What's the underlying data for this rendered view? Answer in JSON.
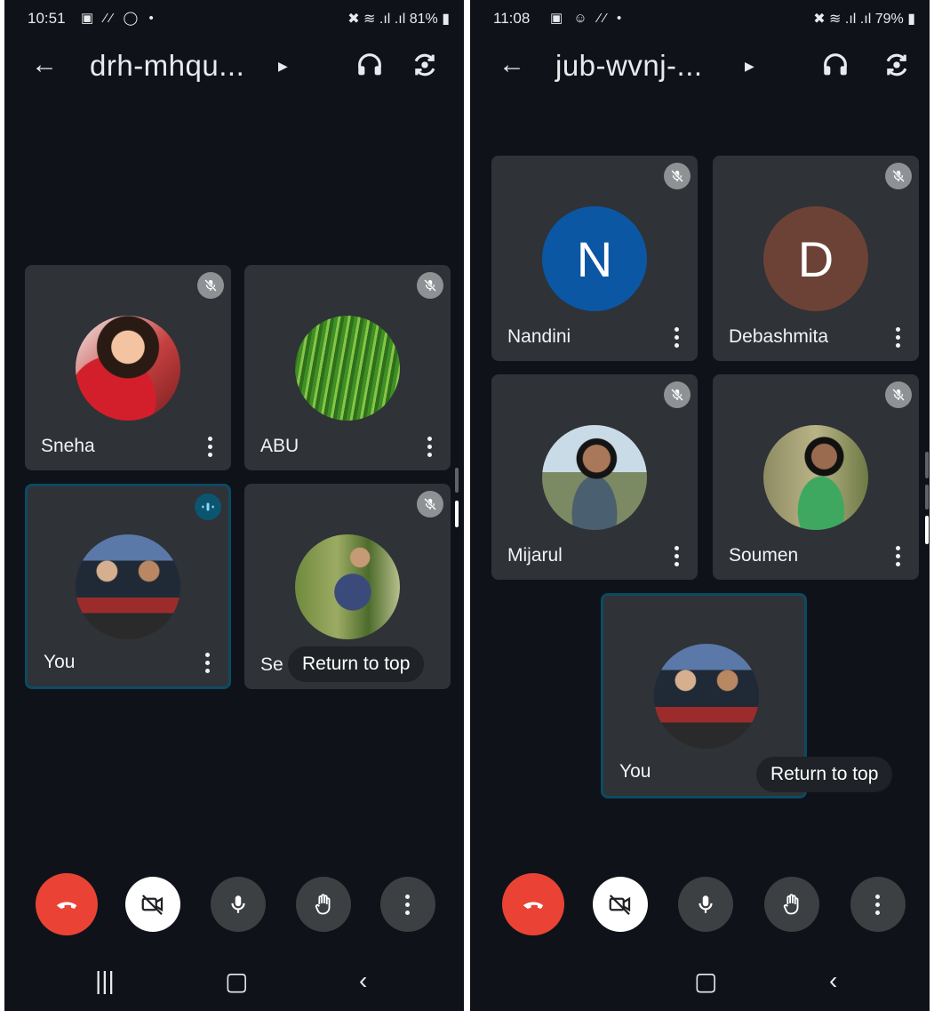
{
  "left": {
    "status": {
      "time": "10:51",
      "battery": "81%"
    },
    "title": "drh-mhqu...",
    "tiles": [
      {
        "name": "Sneha"
      },
      {
        "name": "ABU"
      },
      {
        "name": "You"
      },
      {
        "name": "Se"
      }
    ],
    "return_to_top": "Return to top"
  },
  "right": {
    "status": {
      "time": "11:08",
      "battery": "79%"
    },
    "title": "jub-wvnj-...",
    "tiles": [
      {
        "name": "Nandini",
        "initial": "N"
      },
      {
        "name": "Debashmita",
        "initial": "D"
      },
      {
        "name": "Mijarul"
      },
      {
        "name": "Soumen"
      },
      {
        "name": "You"
      }
    ],
    "return_to_top": "Return to top"
  },
  "colors": {
    "background": "#0f1319",
    "tile": "#2f3237",
    "end_call": "#ea4335",
    "active_border": "#0c4a62",
    "nandini_avatar": "#0b57a4",
    "debashmita_avatar": "#6d4236"
  }
}
